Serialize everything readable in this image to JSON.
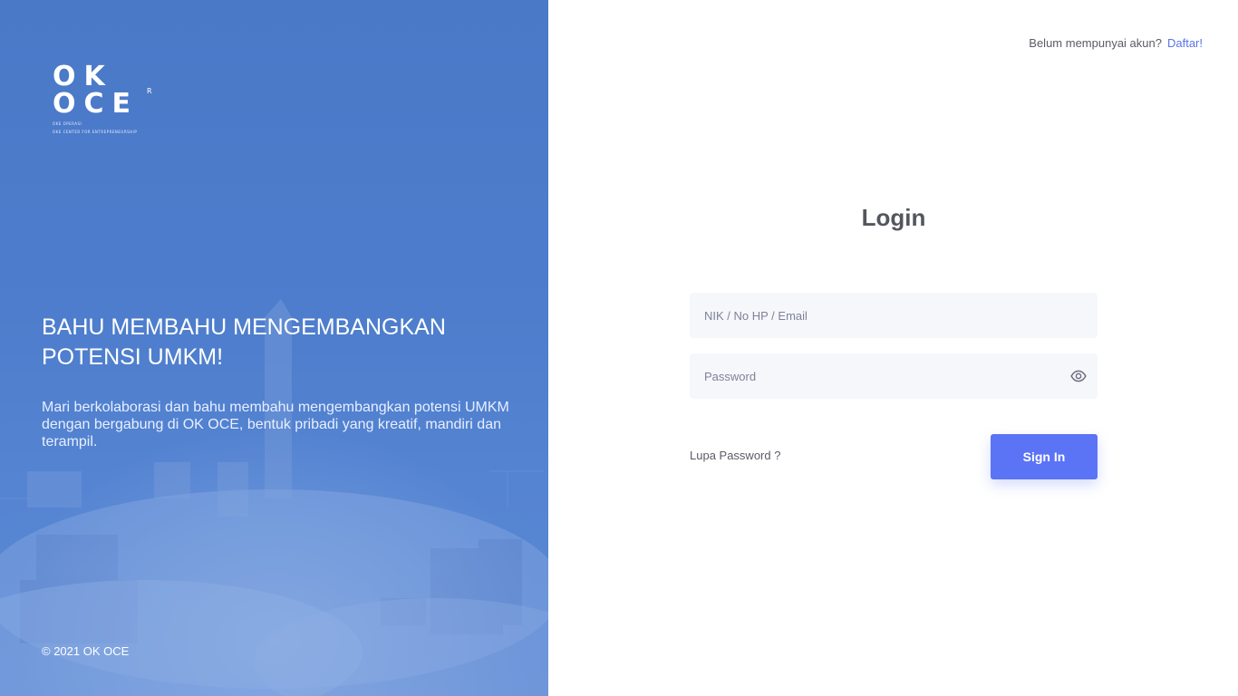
{
  "brand": {
    "logo_line1": "OK",
    "logo_line2": "OCE",
    "logo_reg": "R",
    "logo_sub1": "OKE OPERASI",
    "logo_sub2": "OKE CENTER FOR ENTREPRENEURSHIP"
  },
  "hero": {
    "title": "BAHU MEMBAHU MENGEMBANGKAN POTENSI UMKM!",
    "text": "Mari berkolaborasi dan bahu membahu mengembangkan potensi UMKM dengan bergabung di OK OCE, bentuk pribadi yang kreatif, mandiri dan terampil.",
    "copyright": "© 2021 OK OCE"
  },
  "header": {
    "signup_prompt": "Belum mempunyai akun?",
    "signup_link": "Daftar!"
  },
  "login": {
    "title": "Login",
    "id_placeholder": "NIK / No HP / Email",
    "password_placeholder": "Password",
    "forgot_label": "Lupa Password ?",
    "submit_label": "Sign In"
  },
  "colors": {
    "panel_blue": "#4d7dcc",
    "accent": "#5b74f6",
    "link": "#5b74e8",
    "field_bg": "#f6f7fb"
  },
  "icons": {
    "password_toggle": "eye-icon"
  }
}
